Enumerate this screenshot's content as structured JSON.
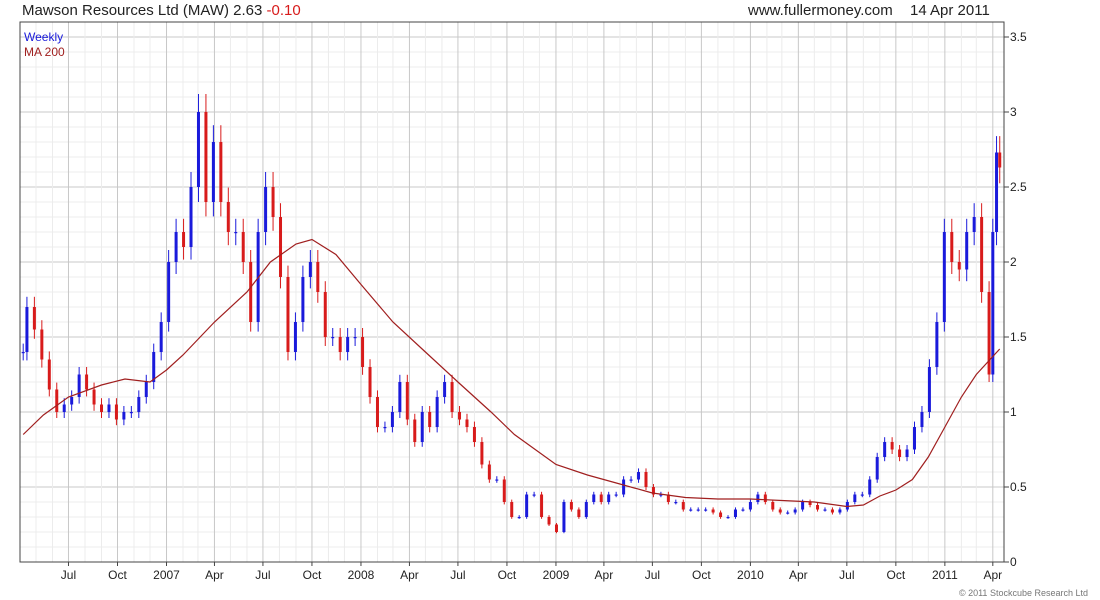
{
  "header": {
    "title": "Mawson Resources Ltd (MAW)",
    "last": "2.63",
    "change": "-0.10",
    "site": "www.fullermoney.com",
    "date": "14 Apr 2011"
  },
  "copyright": "© 2011 Stockcube Research Ltd",
  "colors": {
    "up": "#1a1adb",
    "down": "#d81b1b",
    "ma": "#a01f1f",
    "grid": "#dcdcdc",
    "frame": "#444444"
  },
  "chart_data": {
    "type": "line",
    "legend": [
      {
        "name": "Weekly",
        "color": "#1a1adb"
      },
      {
        "name": "MA 200",
        "color": "#a01f1f"
      }
    ],
    "legend_position": "top-left",
    "grid": true,
    "y_axis_side": "right",
    "ylim": [
      0,
      3.6
    ],
    "y_ticks": [
      0,
      0.5,
      1,
      1.5,
      2,
      2.5,
      3,
      3.5
    ],
    "y_tick_labels": [
      "0",
      "0.5",
      "1",
      "1.5",
      "2",
      "2.5",
      "3",
      "3.5"
    ],
    "x_ticks": [
      {
        "label": "Jul",
        "date": "2006-07-01"
      },
      {
        "label": "Oct",
        "date": "2006-10-01"
      },
      {
        "label": "2007",
        "date": "2007-01-01"
      },
      {
        "label": "Apr",
        "date": "2007-04-01"
      },
      {
        "label": "Jul",
        "date": "2007-07-01"
      },
      {
        "label": "Oct",
        "date": "2007-10-01"
      },
      {
        "label": "2008",
        "date": "2008-01-01"
      },
      {
        "label": "Apr",
        "date": "2008-04-01"
      },
      {
        "label": "Jul",
        "date": "2008-07-01"
      },
      {
        "label": "Oct",
        "date": "2008-10-01"
      },
      {
        "label": "2009",
        "date": "2009-01-01"
      },
      {
        "label": "Apr",
        "date": "2009-04-01"
      },
      {
        "label": "Jul",
        "date": "2009-07-01"
      },
      {
        "label": "Oct",
        "date": "2009-10-01"
      },
      {
        "label": "2010",
        "date": "2010-01-01"
      },
      {
        "label": "Apr",
        "date": "2010-04-01"
      },
      {
        "label": "Jul",
        "date": "2010-07-01"
      },
      {
        "label": "Oct",
        "date": "2010-10-01"
      },
      {
        "label": "2011",
        "date": "2011-01-01"
      },
      {
        "label": "Apr",
        "date": "2011-04-01"
      }
    ],
    "x_range": [
      "2006-04-01",
      "2011-04-22"
    ],
    "price_series": [
      [
        "2006-04-07",
        1.4
      ],
      [
        "2006-04-14",
        1.7
      ],
      [
        "2006-04-28",
        1.55
      ],
      [
        "2006-05-12",
        1.35
      ],
      [
        "2006-05-26",
        1.15
      ],
      [
        "2006-06-09",
        1.0
      ],
      [
        "2006-06-23",
        1.05
      ],
      [
        "2006-07-07",
        1.1
      ],
      [
        "2006-07-21",
        1.25
      ],
      [
        "2006-08-04",
        1.15
      ],
      [
        "2006-08-18",
        1.05
      ],
      [
        "2006-09-01",
        1.0
      ],
      [
        "2006-09-15",
        1.05
      ],
      [
        "2006-09-29",
        0.95
      ],
      [
        "2006-10-13",
        1.0
      ],
      [
        "2006-10-27",
        1.0
      ],
      [
        "2006-11-10",
        1.1
      ],
      [
        "2006-11-24",
        1.2
      ],
      [
        "2006-12-08",
        1.4
      ],
      [
        "2006-12-22",
        1.6
      ],
      [
        "2007-01-05",
        2.0
      ],
      [
        "2007-01-19",
        2.2
      ],
      [
        "2007-02-02",
        2.1
      ],
      [
        "2007-02-16",
        2.5
      ],
      [
        "2007-03-02",
        3.0
      ],
      [
        "2007-03-16",
        2.4
      ],
      [
        "2007-03-30",
        2.8
      ],
      [
        "2007-04-13",
        2.4
      ],
      [
        "2007-04-27",
        2.2
      ],
      [
        "2007-05-11",
        2.2
      ],
      [
        "2007-05-25",
        2.0
      ],
      [
        "2007-06-08",
        1.6
      ],
      [
        "2007-06-22",
        2.2
      ],
      [
        "2007-07-06",
        2.5
      ],
      [
        "2007-07-20",
        2.3
      ],
      [
        "2007-08-03",
        1.9
      ],
      [
        "2007-08-17",
        1.4
      ],
      [
        "2007-08-31",
        1.6
      ],
      [
        "2007-09-14",
        1.9
      ],
      [
        "2007-09-28",
        2.0
      ],
      [
        "2007-10-12",
        1.8
      ],
      [
        "2007-10-26",
        1.5
      ],
      [
        "2007-11-09",
        1.5
      ],
      [
        "2007-11-23",
        1.4
      ],
      [
        "2007-12-07",
        1.5
      ],
      [
        "2007-12-21",
        1.5
      ],
      [
        "2008-01-04",
        1.3
      ],
      [
        "2008-01-18",
        1.1
      ],
      [
        "2008-02-01",
        0.9
      ],
      [
        "2008-02-15",
        0.9
      ],
      [
        "2008-02-29",
        1.0
      ],
      [
        "2008-03-14",
        1.2
      ],
      [
        "2008-03-28",
        0.95
      ],
      [
        "2008-04-11",
        0.8
      ],
      [
        "2008-04-25",
        1.0
      ],
      [
        "2008-05-09",
        0.9
      ],
      [
        "2008-05-23",
        1.1
      ],
      [
        "2008-06-06",
        1.2
      ],
      [
        "2008-06-20",
        1.0
      ],
      [
        "2008-07-04",
        0.95
      ],
      [
        "2008-07-18",
        0.9
      ],
      [
        "2008-08-01",
        0.8
      ],
      [
        "2008-08-15",
        0.65
      ],
      [
        "2008-08-29",
        0.55
      ],
      [
        "2008-09-12",
        0.55
      ],
      [
        "2008-09-26",
        0.4
      ],
      [
        "2008-10-10",
        0.3
      ],
      [
        "2008-10-24",
        0.3
      ],
      [
        "2008-11-07",
        0.45
      ],
      [
        "2008-11-21",
        0.45
      ],
      [
        "2008-12-05",
        0.3
      ],
      [
        "2008-12-19",
        0.25
      ],
      [
        "2009-01-02",
        0.2
      ],
      [
        "2009-01-16",
        0.4
      ],
      [
        "2009-01-30",
        0.35
      ],
      [
        "2009-02-13",
        0.3
      ],
      [
        "2009-02-27",
        0.4
      ],
      [
        "2009-03-13",
        0.45
      ],
      [
        "2009-03-27",
        0.4
      ],
      [
        "2009-04-10",
        0.45
      ],
      [
        "2009-04-24",
        0.45
      ],
      [
        "2009-05-08",
        0.55
      ],
      [
        "2009-05-22",
        0.55
      ],
      [
        "2009-06-05",
        0.6
      ],
      [
        "2009-06-19",
        0.5
      ],
      [
        "2009-07-03",
        0.45
      ],
      [
        "2009-07-17",
        0.45
      ],
      [
        "2009-07-31",
        0.4
      ],
      [
        "2009-08-14",
        0.4
      ],
      [
        "2009-08-28",
        0.35
      ],
      [
        "2009-09-11",
        0.35
      ],
      [
        "2009-09-25",
        0.35
      ],
      [
        "2009-10-09",
        0.35
      ],
      [
        "2009-10-23",
        0.33
      ],
      [
        "2009-11-06",
        0.3
      ],
      [
        "2009-11-20",
        0.3
      ],
      [
        "2009-12-04",
        0.35
      ],
      [
        "2009-12-18",
        0.35
      ],
      [
        "2010-01-01",
        0.4
      ],
      [
        "2010-01-15",
        0.45
      ],
      [
        "2010-01-29",
        0.4
      ],
      [
        "2010-02-12",
        0.35
      ],
      [
        "2010-02-26",
        0.33
      ],
      [
        "2010-03-12",
        0.33
      ],
      [
        "2010-03-26",
        0.35
      ],
      [
        "2010-04-09",
        0.4
      ],
      [
        "2010-04-23",
        0.38
      ],
      [
        "2010-05-07",
        0.35
      ],
      [
        "2010-05-21",
        0.35
      ],
      [
        "2010-06-04",
        0.33
      ],
      [
        "2010-06-18",
        0.35
      ],
      [
        "2010-07-02",
        0.4
      ],
      [
        "2010-07-16",
        0.45
      ],
      [
        "2010-07-30",
        0.45
      ],
      [
        "2010-08-13",
        0.55
      ],
      [
        "2010-08-27",
        0.7
      ],
      [
        "2010-09-10",
        0.8
      ],
      [
        "2010-09-24",
        0.75
      ],
      [
        "2010-10-08",
        0.7
      ],
      [
        "2010-10-22",
        0.75
      ],
      [
        "2010-11-05",
        0.9
      ],
      [
        "2010-11-19",
        1.0
      ],
      [
        "2010-12-03",
        1.3
      ],
      [
        "2010-12-17",
        1.6
      ],
      [
        "2010-12-31",
        2.2
      ],
      [
        "2011-01-14",
        2.0
      ],
      [
        "2011-01-28",
        1.95
      ],
      [
        "2011-02-11",
        2.2
      ],
      [
        "2011-02-25",
        2.3
      ],
      [
        "2011-03-11",
        1.8
      ],
      [
        "2011-03-25",
        1.25
      ],
      [
        "2011-04-01",
        2.2
      ],
      [
        "2011-04-08",
        2.73
      ],
      [
        "2011-04-14",
        2.63
      ]
    ],
    "ma_series": [
      [
        "2006-04-07",
        0.85
      ],
      [
        "2006-05-15",
        0.98
      ],
      [
        "2006-07-01",
        1.1
      ],
      [
        "2006-09-01",
        1.18
      ],
      [
        "2006-10-15",
        1.22
      ],
      [
        "2006-12-01",
        1.2
      ],
      [
        "2007-01-01",
        1.28
      ],
      [
        "2007-02-01",
        1.38
      ],
      [
        "2007-04-01",
        1.6
      ],
      [
        "2007-06-01",
        1.8
      ],
      [
        "2007-07-15",
        2.0
      ],
      [
        "2007-09-01",
        2.12
      ],
      [
        "2007-10-01",
        2.15
      ],
      [
        "2007-11-15",
        2.05
      ],
      [
        "2008-01-01",
        1.85
      ],
      [
        "2008-03-01",
        1.6
      ],
      [
        "2008-05-01",
        1.4
      ],
      [
        "2008-07-01",
        1.2
      ],
      [
        "2008-09-01",
        1.0
      ],
      [
        "2008-10-15",
        0.85
      ],
      [
        "2009-01-01",
        0.65
      ],
      [
        "2009-03-01",
        0.58
      ],
      [
        "2009-05-01",
        0.52
      ],
      [
        "2009-07-01",
        0.46
      ],
      [
        "2009-09-01",
        0.43
      ],
      [
        "2009-11-01",
        0.42
      ],
      [
        "2010-01-01",
        0.42
      ],
      [
        "2010-03-01",
        0.41
      ],
      [
        "2010-05-01",
        0.4
      ],
      [
        "2010-07-01",
        0.37
      ],
      [
        "2010-08-01",
        0.38
      ],
      [
        "2010-09-01",
        0.44
      ],
      [
        "2010-10-01",
        0.48
      ],
      [
        "2010-11-01",
        0.55
      ],
      [
        "2010-12-01",
        0.7
      ],
      [
        "2011-01-01",
        0.9
      ],
      [
        "2011-02-01",
        1.1
      ],
      [
        "2011-03-01",
        1.25
      ],
      [
        "2011-04-14",
        1.42
      ]
    ]
  }
}
